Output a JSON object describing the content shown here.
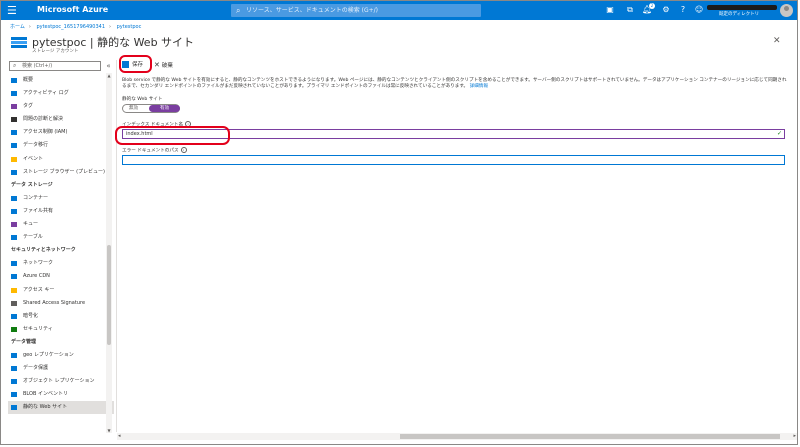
{
  "topbar": {
    "brand": "Microsoft Azure",
    "search_placeholder": "リソース、サービス、ドキュメントの検索 (G+/)",
    "notification_count": "2",
    "account_name": "既定のディレクトリ"
  },
  "breadcrumb": [
    "ホーム",
    "pytestpoc_1651796490341",
    "pytestpoc"
  ],
  "resource": {
    "title": "pytestpoc | 静的な Web サイト",
    "subtitle": "ストレージ アカウント"
  },
  "sidebar": {
    "search_placeholder": "検索 (Ctrl+/)",
    "top_items": [
      {
        "label": "概要",
        "icon": "overview-icon",
        "color": "#0078d4"
      },
      {
        "label": "アクティビティ ログ",
        "icon": "activity-log-icon",
        "color": "#0078d4"
      },
      {
        "label": "タグ",
        "icon": "tag-icon",
        "color": "#7a3ea0"
      },
      {
        "label": "問題の診断と解決",
        "icon": "wrench-icon",
        "color": "#323130"
      },
      {
        "label": "アクセス制御 (IAM)",
        "icon": "iam-icon",
        "color": "#0078d4"
      },
      {
        "label": "データ移行",
        "icon": "data-migration-icon",
        "color": "#0078d4"
      },
      {
        "label": "イベント",
        "icon": "lightning-icon",
        "color": "#ffb900"
      },
      {
        "label": "ストレージ ブラウザー (プレビュー)",
        "icon": "storage-browser-icon",
        "color": "#0078d4"
      }
    ],
    "sections": [
      {
        "title": "データ ストレージ",
        "items": [
          {
            "label": "コンテナー",
            "icon": "container-icon",
            "color": "#0078d4"
          },
          {
            "label": "ファイル共有",
            "icon": "file-share-icon",
            "color": "#0078d4"
          },
          {
            "label": "キュー",
            "icon": "queue-icon",
            "color": "#7a3ea0"
          },
          {
            "label": "テーブル",
            "icon": "table-icon",
            "color": "#0078d4"
          }
        ]
      },
      {
        "title": "セキュリティとネットワーク",
        "items": [
          {
            "label": "ネットワーク",
            "icon": "network-icon",
            "color": "#0078d4"
          },
          {
            "label": "Azure CDN",
            "icon": "cdn-icon",
            "color": "#0078d4"
          },
          {
            "label": "アクセス キー",
            "icon": "key-icon",
            "color": "#ffb900"
          },
          {
            "label": "Shared Access Signature",
            "icon": "link-icon",
            "color": "#605e5c"
          },
          {
            "label": "暗号化",
            "icon": "lock-icon",
            "color": "#0078d4"
          },
          {
            "label": "セキュリティ",
            "icon": "shield-icon",
            "color": "#107c10"
          }
        ]
      },
      {
        "title": "データ管理",
        "items": [
          {
            "label": "geo レプリケーション",
            "icon": "globe-icon",
            "color": "#0078d4"
          },
          {
            "label": "データ保護",
            "icon": "data-protection-icon",
            "color": "#0078d4"
          },
          {
            "label": "オブジェクト レプリケーション",
            "icon": "object-replication-icon",
            "color": "#0078d4"
          },
          {
            "label": "BLOB インベントリ",
            "icon": "blob-inventory-icon",
            "color": "#0078d4"
          },
          {
            "label": "静的な Web サイト",
            "icon": "static-website-icon",
            "color": "#0078d4",
            "active": true
          }
        ]
      }
    ]
  },
  "toolbar": {
    "save_label": "保存",
    "discard_label": "破棄"
  },
  "main": {
    "description": "Blob service で静的な Web サイトを有効にすると、静的なコンテンツをホストできるようになります。Web ページには、静的なコンテンツとクライアント側のスクリプトを含めることができます。サーバー側のスクリプトはサポートされていません。データはアプリケーション コンテナーのリージョンに応じて同期されるまで、セカンダリ エンドポイントのファイルがまだ反映されていないことがあります。プライマリ エンドポイントのファイルは常に反映されていることがあります。",
    "learn_more": "詳細情報",
    "static_site_label": "静的な Web サイト",
    "toggle_off": "無効",
    "toggle_on": "有効",
    "toggle_value": "有効",
    "index_label": "インデックス ドキュメント名",
    "index_value": "index.html",
    "error_label": "エラー ドキュメントのパス",
    "error_value": ""
  }
}
